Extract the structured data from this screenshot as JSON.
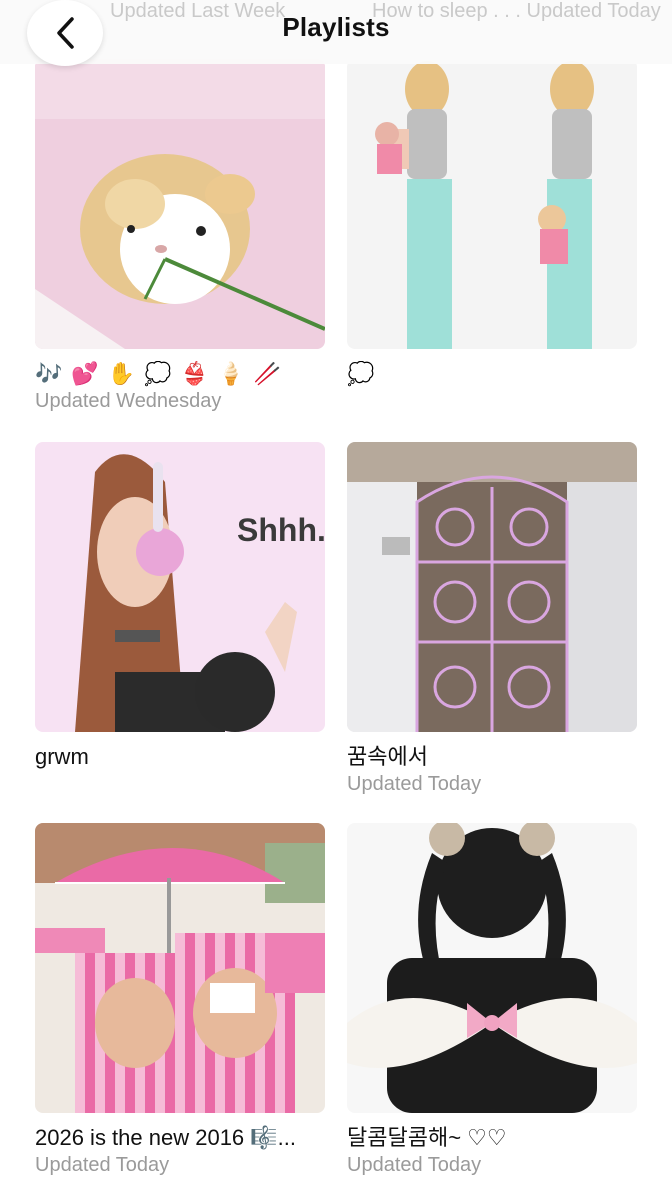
{
  "header": {
    "title": "Playlists",
    "faded_left": "Updated Last Week",
    "faded_right": "How to sleep . . . Updated Today"
  },
  "playlists": [
    {
      "title": "",
      "title_emojis": [
        "🎶",
        "💕",
        "✋",
        "💭",
        "👙",
        "🍦",
        "🥢"
      ],
      "subtitle": "Updated Wednesday",
      "thumb": "guinea-pig-on-pink-blanket"
    },
    {
      "title": "💭",
      "subtitle": "",
      "thumb": "two-blonde-women-with-dolls"
    },
    {
      "title": "grwm",
      "subtitle": "",
      "thumb": "girl-with-pink-headphones",
      "thumb_text": "Shhh..."
    },
    {
      "title": "꿈속에서",
      "subtitle": "Updated Today",
      "thumb": "pink-iron-gate"
    },
    {
      "title": "2026 is the new 2016 🎼...",
      "subtitle": "Updated Today",
      "thumb": "pink-beach-loungers"
    },
    {
      "title": "달콤달콤해~ ♡♡",
      "subtitle": "Updated Today",
      "thumb": "girl-with-angel-wings-backpack"
    }
  ],
  "colors": {
    "title_text": "#111111",
    "subtitle_text": "#9a9a9a",
    "accent_pink": "#e86aa6"
  }
}
